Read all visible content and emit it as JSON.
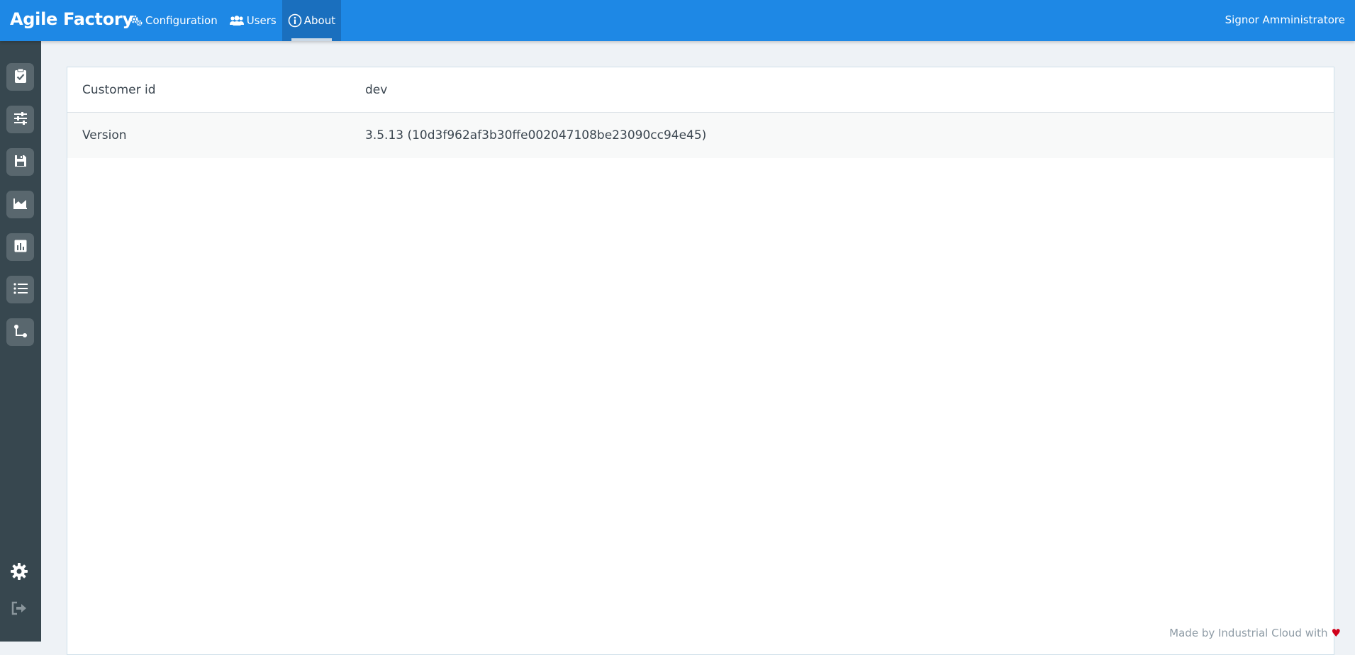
{
  "app": {
    "title": "Agile Factory"
  },
  "nav": {
    "items": [
      {
        "label": "Configuration",
        "icon": "cogs-icon"
      },
      {
        "label": "Users",
        "icon": "users-icon"
      },
      {
        "label": "About",
        "icon": "info-circle-icon",
        "active": true
      }
    ]
  },
  "user": {
    "name": "Signor Amministratore"
  },
  "sidebar": {
    "items": [
      {
        "icon": "clipboard-check-icon"
      },
      {
        "icon": "sliders-icon"
      },
      {
        "icon": "floppy-disk-icon"
      },
      {
        "icon": "area-chart-icon"
      },
      {
        "icon": "bar-chart-icon"
      },
      {
        "icon": "list-icon"
      },
      {
        "icon": "flow-icon"
      }
    ],
    "bottom": [
      {
        "icon": "gear-icon"
      },
      {
        "icon": "sign-out-icon"
      }
    ]
  },
  "about": {
    "rows": [
      {
        "label": "Customer id",
        "value": "dev"
      },
      {
        "label": "Version",
        "value": "3.5.13 (10d3f962af3b30ffe002047108be23090cc94e45)"
      }
    ]
  },
  "footer": {
    "credit": "Made by Industrial Cloud with"
  },
  "colors": {
    "topbar": "#1e88e5",
    "sidebar": "#37474f",
    "heart": "#d0021b"
  }
}
